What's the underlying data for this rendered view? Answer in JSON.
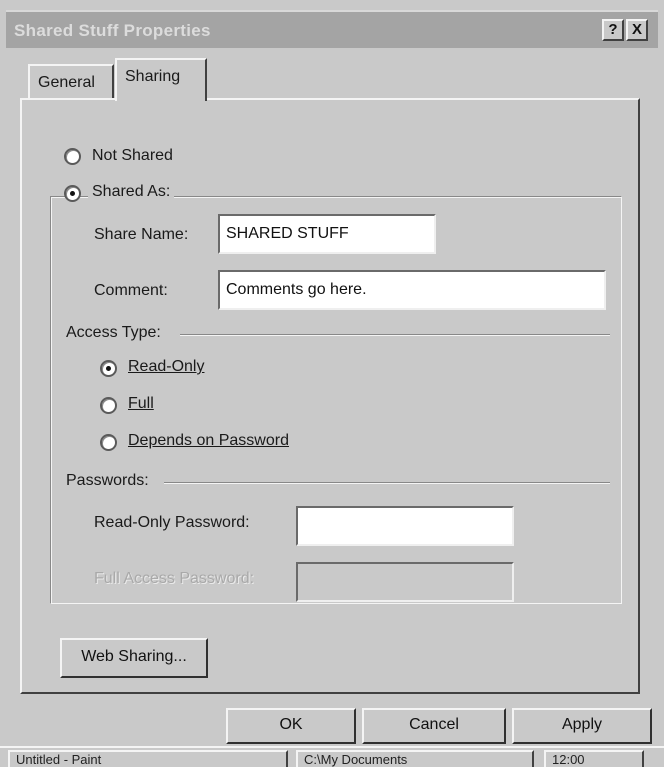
{
  "window": {
    "title": "Shared Stuff Properties",
    "help_label": "?",
    "close_label": "X"
  },
  "tabs": [
    {
      "label": "General"
    },
    {
      "label": "Sharing"
    }
  ],
  "sharing": {
    "not_shared_label": "Not Shared",
    "shared_as_label": "Shared As:",
    "selected": "shared_as",
    "share_name_label": "Share Name:",
    "share_name_value": "SHARED STUFF",
    "comment_label": "Comment:",
    "comment_value": "Comments go here.",
    "access_type_label": "Access Type:",
    "access_options": [
      {
        "label": "Read-Only",
        "checked": true
      },
      {
        "label": "Full",
        "checked": false
      },
      {
        "label": "Depends on Password",
        "checked": false
      }
    ],
    "passwords_label": "Passwords:",
    "readonly_password_label": "Read-Only Password:",
    "readonly_password_value": "",
    "full_password_label": "Full Access Password:",
    "full_password_value": ""
  },
  "buttons": {
    "web_sharing": "Web Sharing...",
    "ok": "OK",
    "cancel": "Cancel",
    "apply": "Apply"
  },
  "taskbar": {
    "items": [
      {
        "label": "Untitled - Paint"
      },
      {
        "label": "C:\\My Documents"
      },
      {
        "label": "12:00"
      }
    ]
  }
}
